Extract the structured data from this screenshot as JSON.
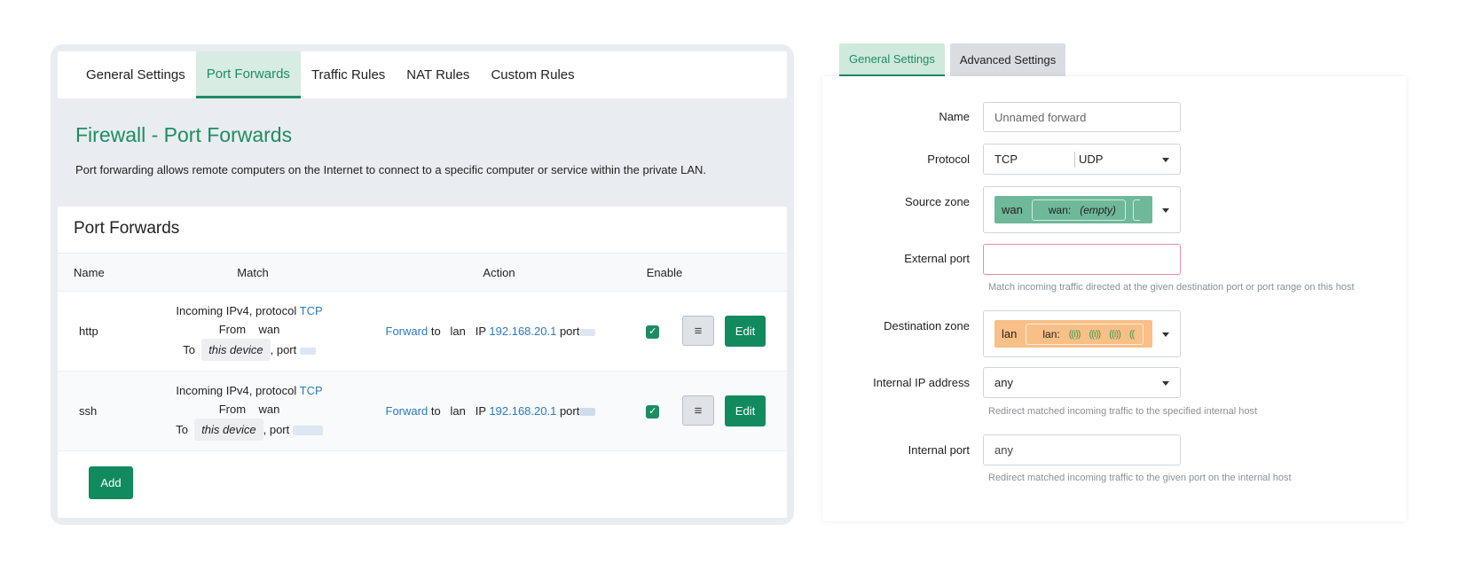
{
  "left": {
    "tabs": [
      "General Settings",
      "Port Forwards",
      "Traffic Rules",
      "NAT Rules",
      "Custom Rules"
    ],
    "title": "Firewall - Port Forwards",
    "description": "Port forwarding allows remote computers on the Internet to connect to a specific computer or service within the private LAN.",
    "section_title": "Port Forwards",
    "columns": {
      "name": "Name",
      "match": "Match",
      "action": "Action",
      "enable": "Enable"
    },
    "rows": [
      {
        "name": "http",
        "match_incoming": "Incoming IPv4, protocol",
        "protocol": "TCP",
        "from_label": "From",
        "from_zone": "wan",
        "to_label": "To",
        "to_device": "this device",
        "port_label": ", port",
        "action_forward": "Forward",
        "action_to": "to",
        "action_zone": "lan",
        "action_ip_label": "IP",
        "action_ip": "192.168.20.1",
        "action_port_label": "port",
        "enabled": true
      },
      {
        "name": "ssh",
        "match_incoming": "Incoming IPv4, protocol",
        "protocol": "TCP",
        "from_label": "From",
        "from_zone": "wan",
        "to_label": "To",
        "to_device": "this device",
        "port_label": ", port",
        "action_forward": "Forward",
        "action_to": "to",
        "action_zone": "lan",
        "action_ip_label": "IP",
        "action_ip": "192.168.20.1",
        "action_port_label": "port",
        "enabled": true
      }
    ],
    "menu_button": "≡",
    "edit_button": "Edit",
    "add_button": "Add"
  },
  "right": {
    "tabs": [
      "General Settings",
      "Advanced Settings"
    ],
    "name_label": "Name",
    "name_placeholder": "Unnamed forward",
    "protocol_label": "Protocol",
    "protocol_values": [
      "TCP",
      "UDP"
    ],
    "source_zone_label": "Source zone",
    "source_zone_name": "wan",
    "source_zone_detail": "wan:",
    "source_zone_empty": "(empty)",
    "external_port_label": "External port",
    "external_port_hint": "Match incoming traffic directed at the given destination port or port range on this host",
    "destination_zone_label": "Destination zone",
    "destination_zone_name": "lan",
    "destination_zone_detail": "lan:",
    "internal_ip_label": "Internal IP address",
    "internal_ip_value": "any",
    "internal_ip_hint": "Redirect matched incoming traffic to the specified internal host",
    "internal_port_label": "Internal port",
    "internal_port_placeholder": "any",
    "internal_port_hint": "Redirect matched incoming traffic to the given port on the internal host"
  },
  "colors": {
    "accent": "#1e8c63",
    "link": "#2a79c4",
    "wan_zone": "#6fb89a",
    "lan_zone": "#f8bf86",
    "error_border": "#e88aa6"
  }
}
